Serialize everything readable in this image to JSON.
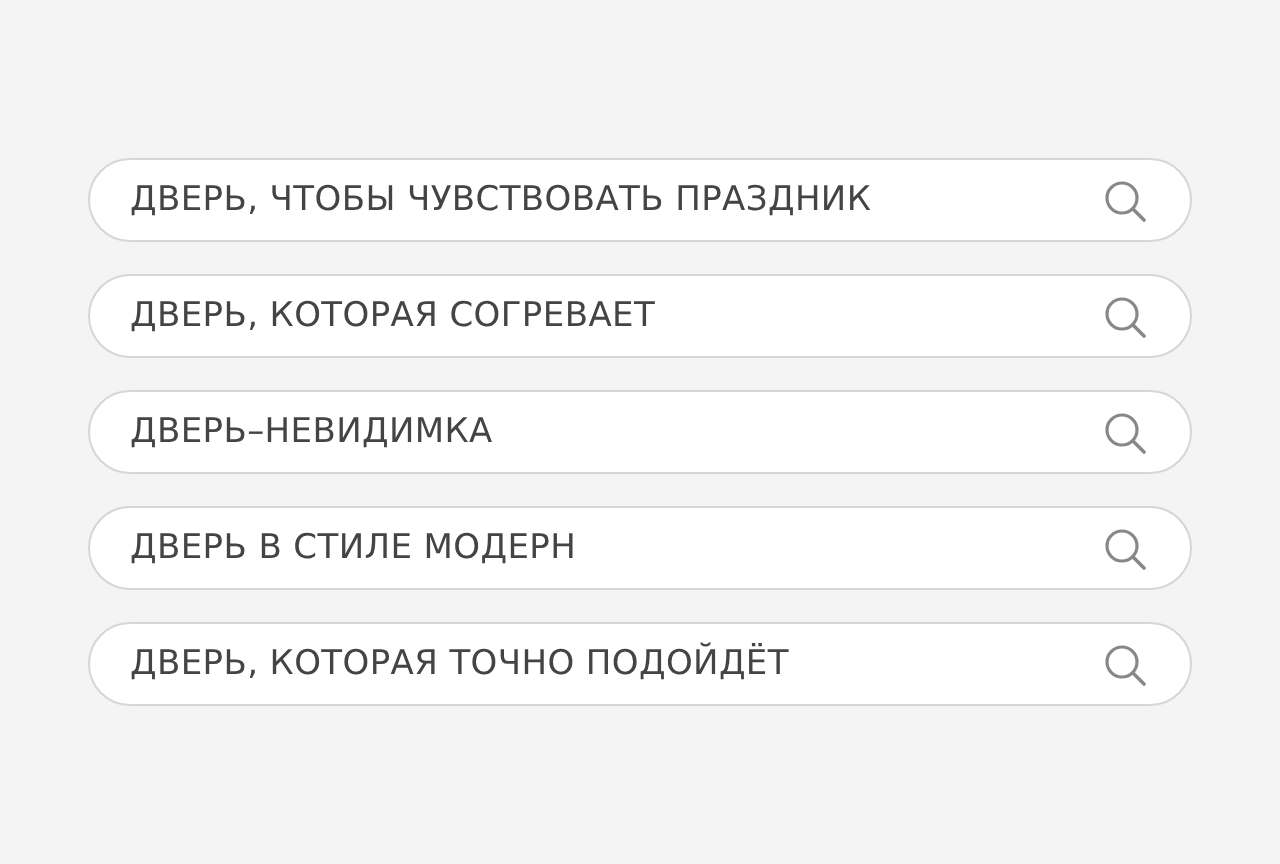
{
  "search_fields": [
    {
      "value": "ДВЕРЬ, ЧТОБЫ ЧУВСТВОВАТЬ ПРАЗДНИК"
    },
    {
      "value": "ДВЕРЬ, КОТОРАЯ СОГРЕВАЕТ"
    },
    {
      "value": "ДВЕРЬ–НЕВИДИМКА"
    },
    {
      "value": "ДВЕРЬ В СТИЛЕ МОДЕРН"
    },
    {
      "value": "ДВЕРЬ, КОТОРАЯ ТОЧНО ПОДОЙДЁТ"
    }
  ]
}
